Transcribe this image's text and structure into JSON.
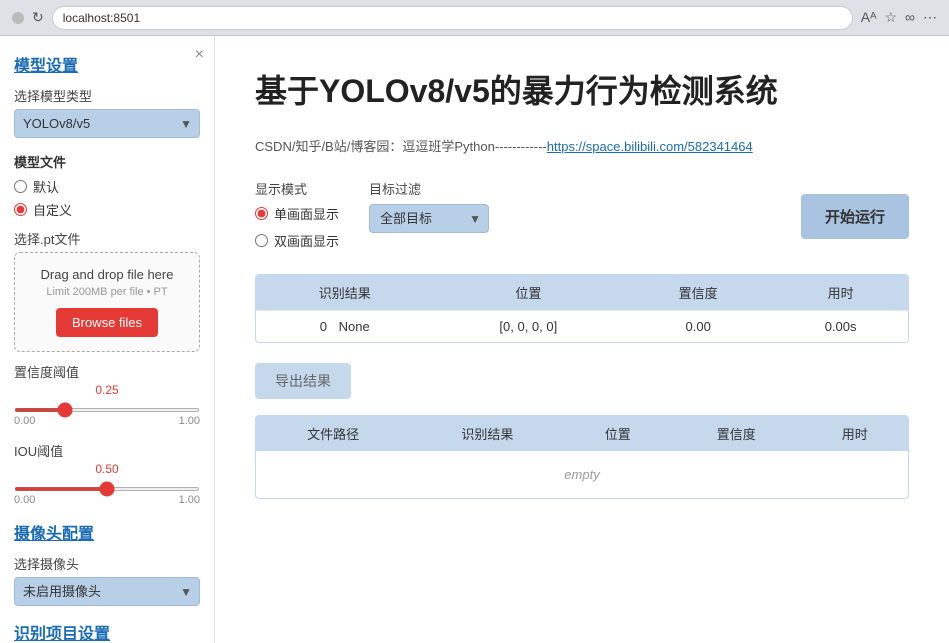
{
  "browser": {
    "url": "localhost:8501"
  },
  "sidebar": {
    "close_label": "×",
    "model_settings_title": "模型设置",
    "model_type_label": "选择模型类型",
    "model_type_options": [
      "YOLOv8/v5"
    ],
    "model_type_selected": "YOLOv8/v5",
    "model_file_title": "模型文件",
    "radio_default_label": "默认",
    "radio_custom_label": "自定义",
    "select_pt_label": "选择.pt文件",
    "drop_title": "Drag and drop file here",
    "drop_limit": "Limit 200MB per file • PT",
    "browse_label": "Browse files",
    "confidence_title": "置信度阈值",
    "confidence_value": "0.25",
    "confidence_min": "0.00",
    "confidence_max": "1.00",
    "iou_title": "IOU阈值",
    "iou_value": "0.50",
    "iou_min": "0.00",
    "iou_max": "1.00",
    "camera_title": "摄像头配置",
    "camera_select_label": "选择摄像头",
    "camera_options": [
      "未启用摄像头"
    ],
    "camera_selected": "未启用摄像头",
    "recognition_title": "识别项目设置"
  },
  "main": {
    "title": "基于YOLOv8/v5的暴力行为检测系统",
    "info_prefix": "CSDN/知乎/B站/博客园：逗逗班学Python------------",
    "info_link_text": "https://space.bilibili.com/582341464",
    "info_link_url": "https://space.bilibili.com/582341464",
    "display_mode_label": "显示模式",
    "radio_single_label": "单画面显示",
    "radio_dual_label": "双画面显示",
    "target_filter_label": "目标过滤",
    "target_filter_options": [
      "全部目标"
    ],
    "target_filter_selected": "全部目标",
    "run_button_label": "开始运行",
    "result_table": {
      "headers": [
        "识别结果",
        "位置",
        "置信度",
        "用时"
      ],
      "rows": [
        {
          "index": "0",
          "result": "None",
          "position": "[0, 0, 0, 0]",
          "confidence": "0.00",
          "time": "0.00s"
        }
      ]
    },
    "export_button_label": "导出结果",
    "bottom_table": {
      "headers": [
        "文件路径",
        "识别结果",
        "位置",
        "置信度",
        "用时"
      ],
      "empty_text": "empty"
    }
  }
}
